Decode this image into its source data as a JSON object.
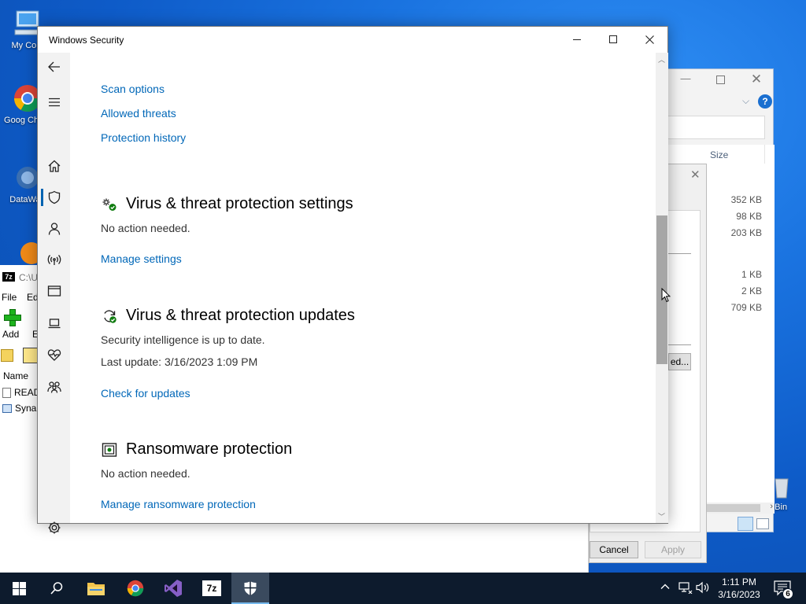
{
  "desktop": {
    "icons": [
      {
        "label": "My Com"
      },
      {
        "label": "Goog Chron"
      },
      {
        "label": "DataWag"
      },
      {
        "label": "e Bin"
      }
    ]
  },
  "sevenzip": {
    "path": "C:\\U",
    "menu": [
      "File",
      "Edi"
    ],
    "toolbar": [
      "Add",
      "E"
    ],
    "column_name": "Name",
    "files": [
      "READ",
      "Synap"
    ]
  },
  "explorer": {
    "column_size": "Size",
    "sizes": [
      "352 KB",
      "98 KB",
      "203 KB",
      "1 KB",
      "2 KB",
      "709 KB"
    ]
  },
  "properties": {
    "advanced_button": "ed...",
    "cancel_button": "Cancel",
    "apply_button": "Apply"
  },
  "windows_security": {
    "title": "Windows Security",
    "links_top": [
      "Scan options",
      "Allowed threats",
      "Protection history"
    ],
    "sections": [
      {
        "heading": "Virus & threat protection settings",
        "icon": "gear-shield-icon",
        "lines": [
          "No action needed."
        ],
        "link": "Manage settings"
      },
      {
        "heading": "Virus & threat protection updates",
        "icon": "refresh-icon",
        "lines": [
          "Security intelligence is up to date.",
          "Last update: 3/16/2023 1:09 PM"
        ],
        "link": "Check for updates"
      },
      {
        "heading": "Ransomware protection",
        "icon": "ransomware-icon",
        "lines": [
          "No action needed."
        ],
        "link": "Manage ransomware protection"
      }
    ]
  },
  "taskbar": {
    "time": "1:11 PM",
    "date": "3/16/2023",
    "notification_count": "6"
  }
}
